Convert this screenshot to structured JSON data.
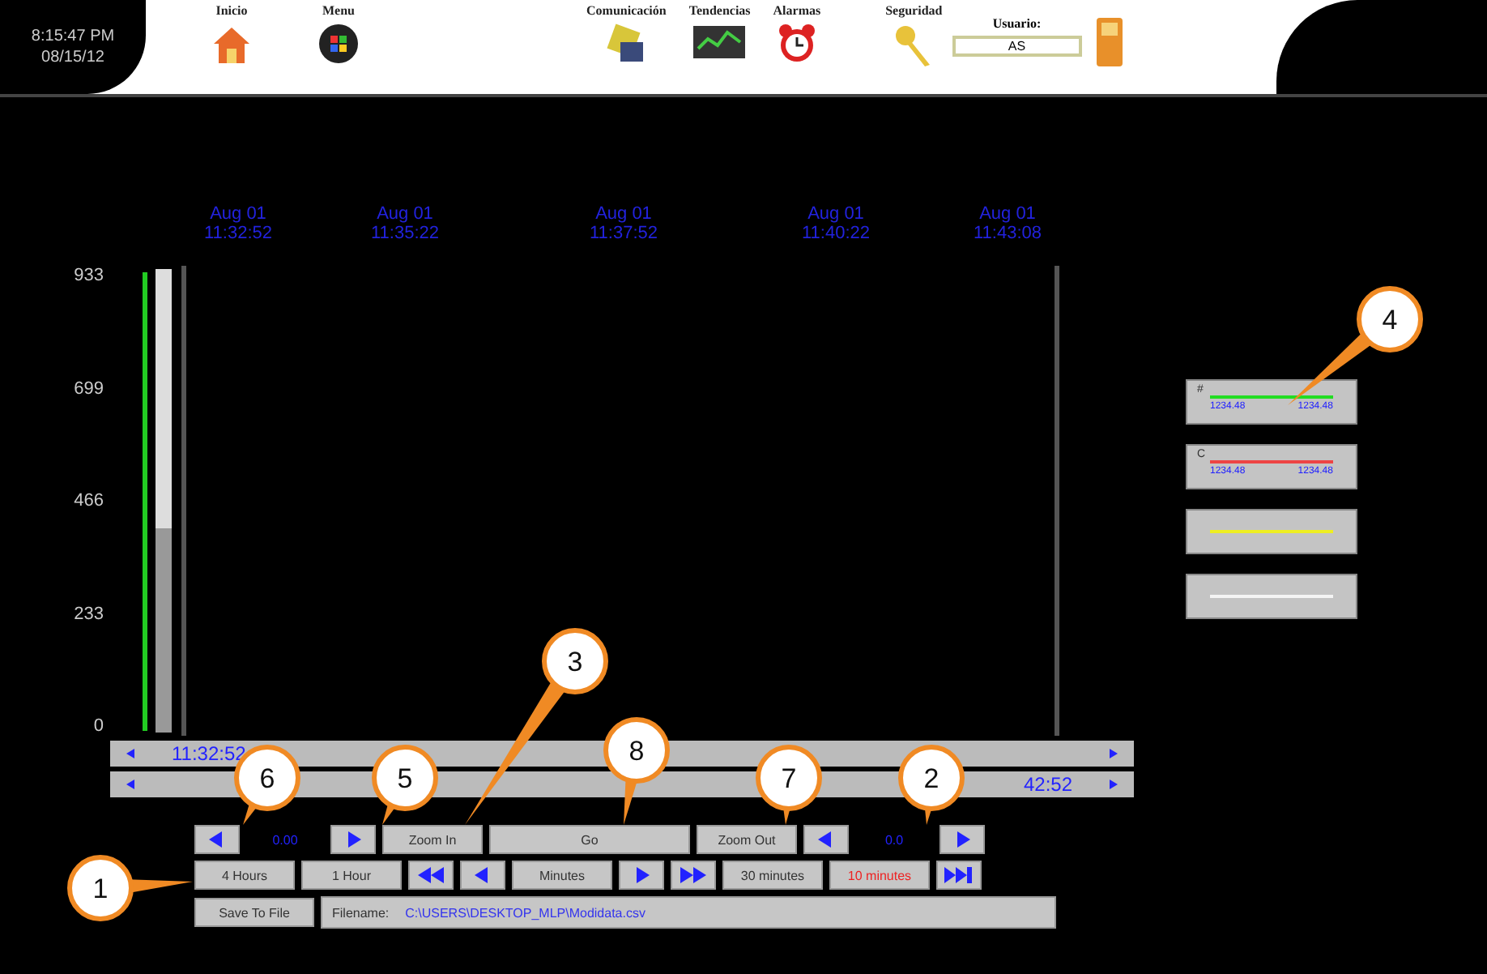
{
  "header": {
    "time": "8:15:47 PM",
    "date": "08/15/12",
    "nav": [
      {
        "label": "Inicio",
        "kind": "house"
      },
      {
        "label": "Menu",
        "kind": "orb"
      },
      {
        "label": "Comunicación",
        "kind": "chip"
      },
      {
        "label": "Tendencias",
        "kind": "monitor"
      },
      {
        "label": "Alarmas",
        "kind": "clock"
      },
      {
        "label": "Seguridad",
        "kind": "key"
      }
    ],
    "user_label": "Usuario:",
    "user": "AS"
  },
  "chart": {
    "time_labels": [
      {
        "date": "Aug 01",
        "time": "11:32:52"
      },
      {
        "date": "Aug 01",
        "time": "11:35:22"
      },
      {
        "date": "Aug 01",
        "time": "11:37:52"
      },
      {
        "date": "Aug 01",
        "time": "11:40:22"
      },
      {
        "date": "Aug 01",
        "time": "11:43:08"
      }
    ],
    "y_labels": [
      "933",
      "699",
      "466",
      "233",
      "0"
    ]
  },
  "scrollbars": [
    {
      "text": "11:32:52"
    },
    {
      "text": "42:52"
    }
  ],
  "legend": [
    {
      "label": "#",
      "color": "#22dd22",
      "min": "1234.48",
      "max": "1234.48"
    },
    {
      "label": "C",
      "color": "#ee4444",
      "min": "1234.48",
      "max": "1234.48"
    },
    {
      "color": "#eeee22"
    },
    {
      "color": "#f4f4f4"
    }
  ],
  "controls": [
    [
      {
        "kind": "left"
      },
      {
        "kind": "readout",
        "text": "0.00"
      },
      {
        "kind": "right"
      },
      {
        "kind": "button",
        "text": "Zoom In"
      },
      {
        "kind": "wide",
        "text": "Go"
      },
      {
        "kind": "button",
        "text": "Zoom Out"
      },
      {
        "kind": "left"
      },
      {
        "kind": "readout",
        "text": "0.0"
      },
      {
        "kind": "right"
      }
    ],
    [
      {
        "kind": "button",
        "text": "4 Hours",
        "selected": false
      },
      {
        "kind": "button",
        "text": "1 Hour",
        "selected": false
      },
      {
        "kind": "rewind"
      },
      {
        "kind": "left"
      },
      {
        "kind": "button",
        "text": "Minutes",
        "selected": false
      },
      {
        "kind": "right"
      },
      {
        "kind": "forward"
      },
      {
        "kind": "button",
        "text": "30 minutes",
        "selected": false
      },
      {
        "kind": "button",
        "text": "10 minutes",
        "selected": true
      },
      {
        "kind": "end"
      }
    ]
  ],
  "file": {
    "button": "Save To File",
    "label": "Filename:",
    "path": "C:\\USERS\\DESKTOP_MLP\\Modidata.csv"
  },
  "callouts": [
    "4",
    "3",
    "8",
    "6",
    "5",
    "7",
    "2",
    "1"
  ]
}
